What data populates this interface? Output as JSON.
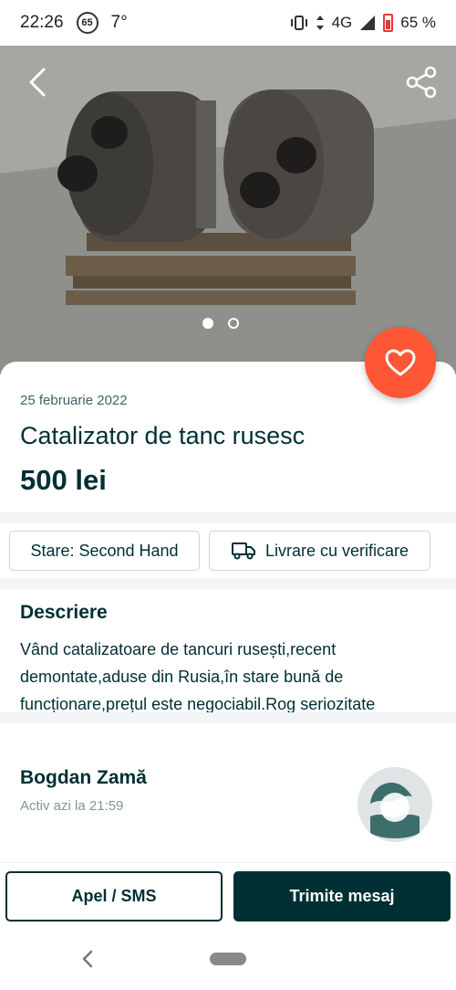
{
  "status_bar": {
    "time": "22:26",
    "speed_badge": "65",
    "temperature": "7°",
    "network": "4G",
    "battery": "65 %"
  },
  "gallery": {
    "image_count": 2,
    "active_index": 0,
    "icons": [
      "back-arrow-icon",
      "share-icon",
      "heart-icon"
    ]
  },
  "listing": {
    "date": "25 februarie 2022",
    "title": "Catalizator de tanc rusesc",
    "price": "500 lei"
  },
  "chips": [
    {
      "label": "Stare: Second Hand",
      "icon": ""
    },
    {
      "label": "Livrare cu verificare",
      "icon": "truck-icon"
    }
  ],
  "description": {
    "heading": "Descriere",
    "text": "Vând catalizatoare de tancuri rusești,recent demontate,aduse din Rusia,în stare bună de funcționare,prețul este negociabil.Rog seriozitate"
  },
  "seller": {
    "name": "Bogdan Zamă",
    "last_active": "Activ azi la 21:59"
  },
  "actions": {
    "call_label": "Apel / SMS",
    "message_label": "Trimite mesaj"
  },
  "colors": {
    "brand_dark": "#002f34",
    "favorite": "#ff5636"
  }
}
